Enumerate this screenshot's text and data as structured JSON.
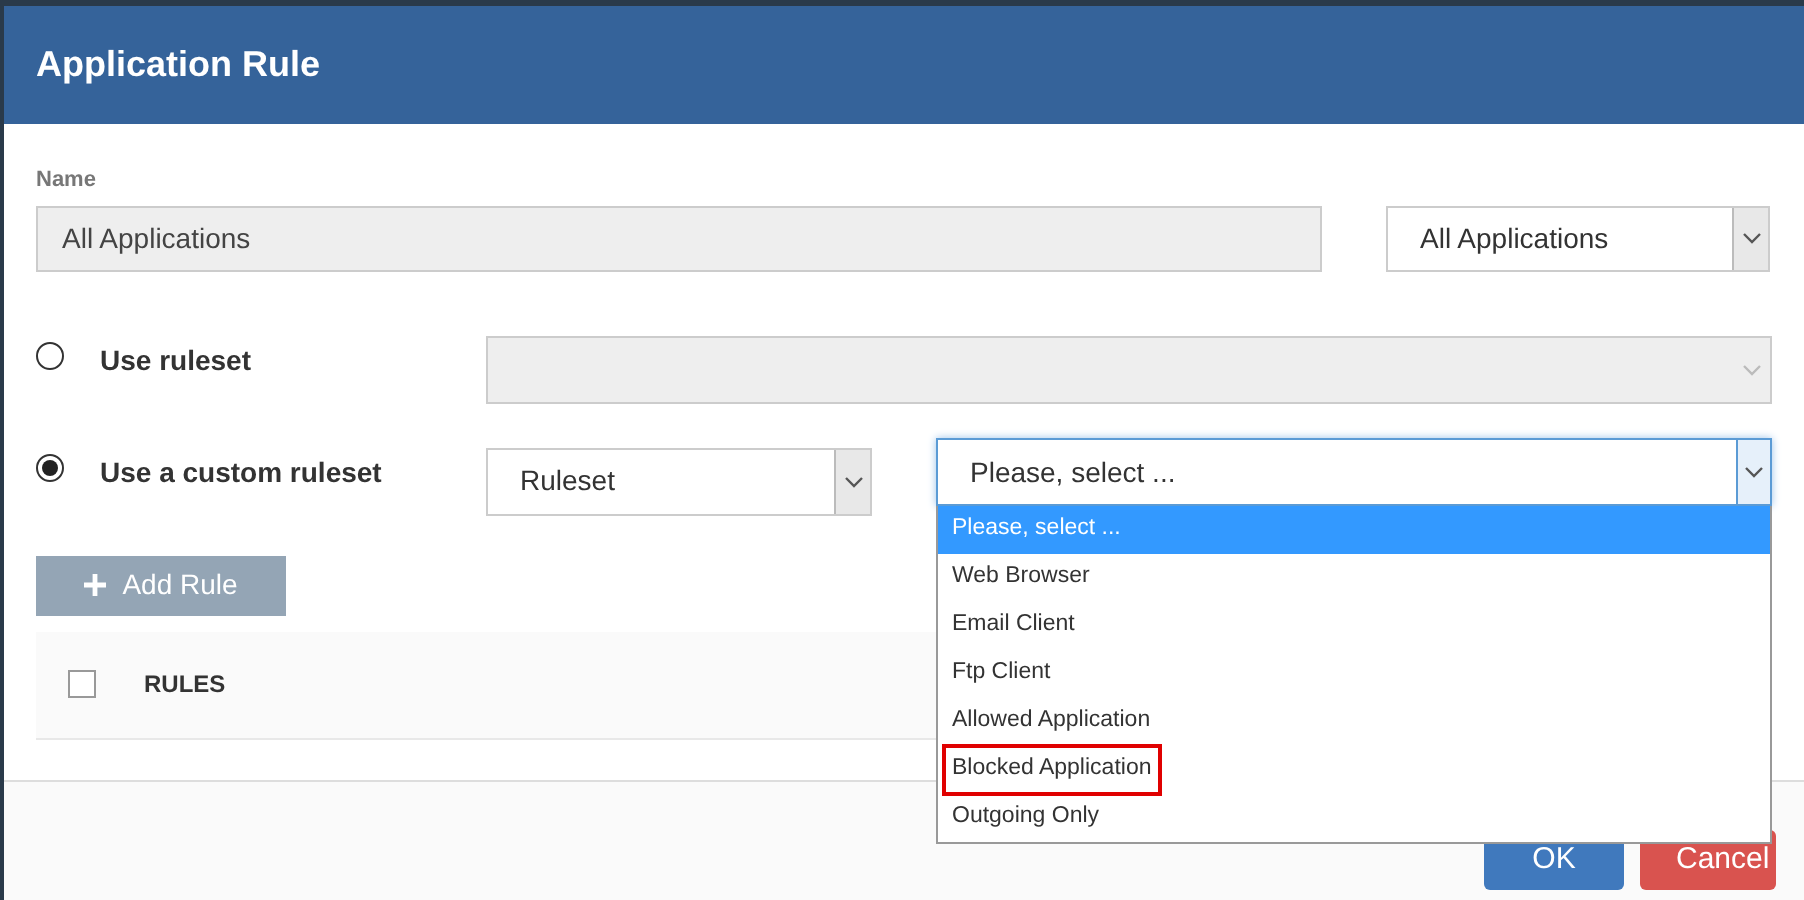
{
  "dialog": {
    "title": "Application Rule"
  },
  "name_field": {
    "label": "Name",
    "value": "All Applications"
  },
  "name_select": {
    "value": "All Applications"
  },
  "ruleset_options": [
    {
      "label": "Use ruleset",
      "selected": false,
      "kind": "empty"
    },
    {
      "label": "Use a custom ruleset",
      "selected": true,
      "kind": "filled",
      "select_value": "Ruleset"
    }
  ],
  "app_select": {
    "value": "Please, select ...",
    "expanded": true,
    "options": [
      {
        "label": "Please, select ...",
        "selected": true,
        "outlined": false
      },
      {
        "label": "Web Browser",
        "selected": false,
        "outlined": false
      },
      {
        "label": "Email Client",
        "selected": false,
        "outlined": false
      },
      {
        "label": "Ftp Client",
        "selected": false,
        "outlined": false
      },
      {
        "label": "Allowed Application",
        "selected": false,
        "outlined": false
      },
      {
        "label": "Blocked Application",
        "selected": false,
        "outlined": true
      },
      {
        "label": "Outgoing Only",
        "selected": false,
        "outlined": false
      }
    ]
  },
  "add_button": {
    "label": "Add Rule"
  },
  "rules_table": {
    "header": "RULES",
    "checked": false
  },
  "footer": {
    "buttons": [
      {
        "label": "OK",
        "kind": "primary"
      },
      {
        "label": "Cancel",
        "kind": "danger"
      }
    ]
  }
}
